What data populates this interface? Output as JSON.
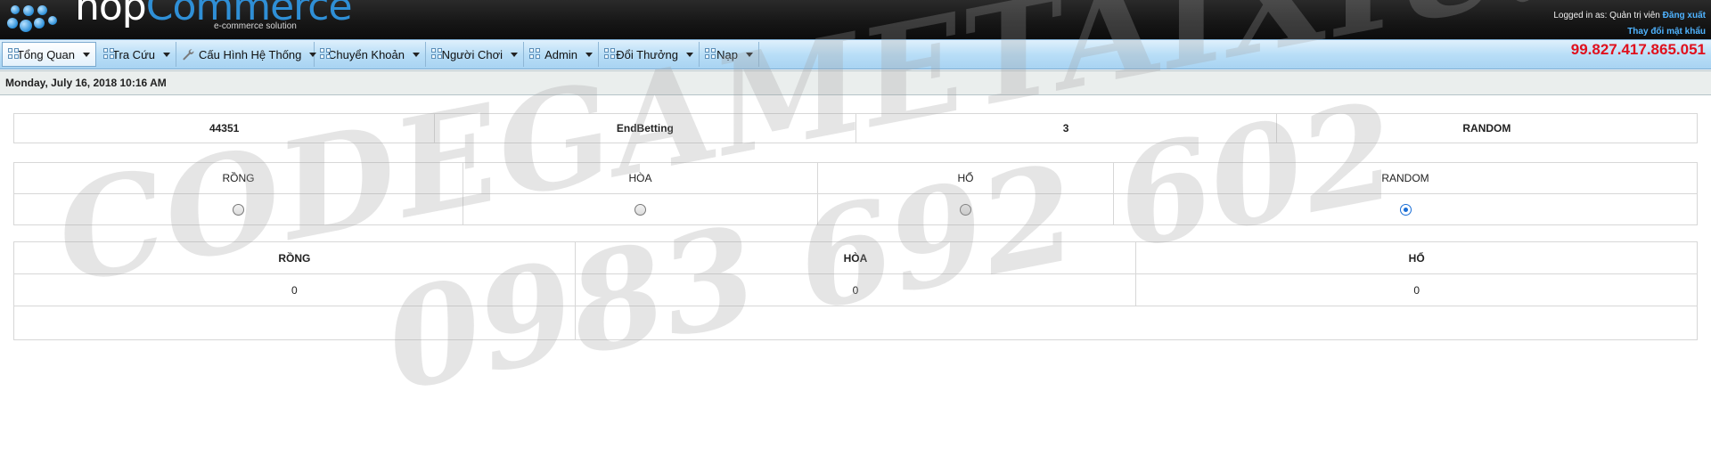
{
  "header": {
    "logo_nop": "nop",
    "logo_commerce": "Commerce",
    "logo_sub": "e-commerce solution",
    "login_prefix": "Logged in as: Quản trị viên",
    "logout_label": "Đăng xuất",
    "change_password_label": "Thay đổi mật khẩu",
    "balance": "99.827.417.865.051"
  },
  "menu": {
    "items": [
      {
        "label": "Tổng Quan",
        "icon": "grid-icon"
      },
      {
        "label": "Tra Cứu",
        "icon": "grid-icon"
      },
      {
        "label": "Cấu Hình Hệ Thống",
        "icon": "wrench-icon"
      },
      {
        "label": "Chuyển Khoản",
        "icon": "grid-icon"
      },
      {
        "label": "Người Chơi",
        "icon": "grid-icon"
      },
      {
        "label": "Admin",
        "icon": "grid-icon"
      },
      {
        "label": "Đổi Thưởng",
        "icon": "grid-icon"
      },
      {
        "label": "Nạp",
        "icon": "grid-icon"
      }
    ]
  },
  "datebar": {
    "text": "Monday, July 16, 2018 10:16 AM"
  },
  "info": {
    "session": "44351",
    "state": "EndBetting",
    "count": "3",
    "mode": "RANDOM"
  },
  "choices": {
    "labels": [
      "RỒNG",
      "HÒA",
      "HỔ",
      "RANDOM"
    ],
    "selected": "RANDOM"
  },
  "results": {
    "headers": [
      "RỒNG",
      "HÒA",
      "HỔ"
    ],
    "values": [
      "0",
      "0",
      "0"
    ]
  },
  "watermark": {
    "line1": "CODEGAMETAIXIU.COM",
    "line2": "0983 692 602"
  }
}
